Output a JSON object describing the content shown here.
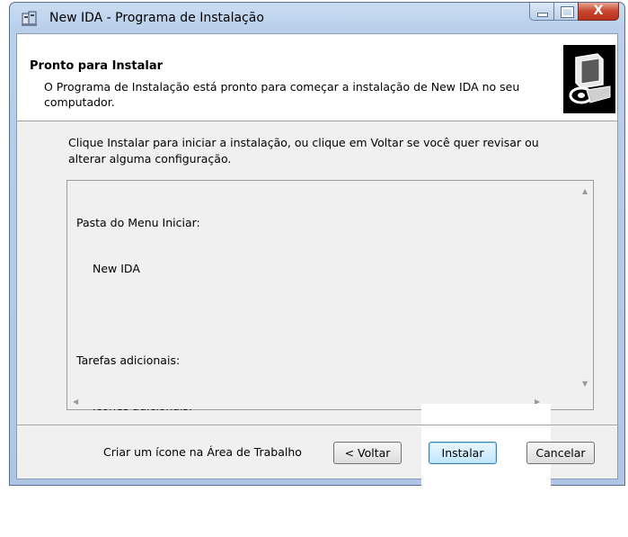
{
  "window": {
    "title": "New IDA - Programa de Instalação",
    "close_glyph": "X"
  },
  "header": {
    "title": "Pronto para Instalar",
    "description": "O Programa de Instalação está pronto para começar a instalação de New IDA no seu computador."
  },
  "intro_text": "Clique Instalar para iniciar a instalação, ou clique em Voltar se você quer revisar ou alterar alguma configuração.",
  "memo": {
    "lines": [
      {
        "text": "Pasta do Menu Iniciar:",
        "indent": 0
      },
      {
        "text": "New IDA",
        "indent": 1
      },
      {
        "text": "",
        "indent": 0
      },
      {
        "text": "Tarefas adicionais:",
        "indent": 0
      },
      {
        "text": "Ícones adicionais:",
        "indent": 2
      },
      {
        "text": "Criar um ícone na Área de Trabalho",
        "indent": 3
      }
    ]
  },
  "buttons": {
    "back": "< Voltar",
    "install": "Instalar",
    "cancel": "Cancelar"
  },
  "icons": {
    "app": "installer-icon",
    "wizard": "computer-disk-icon"
  }
}
